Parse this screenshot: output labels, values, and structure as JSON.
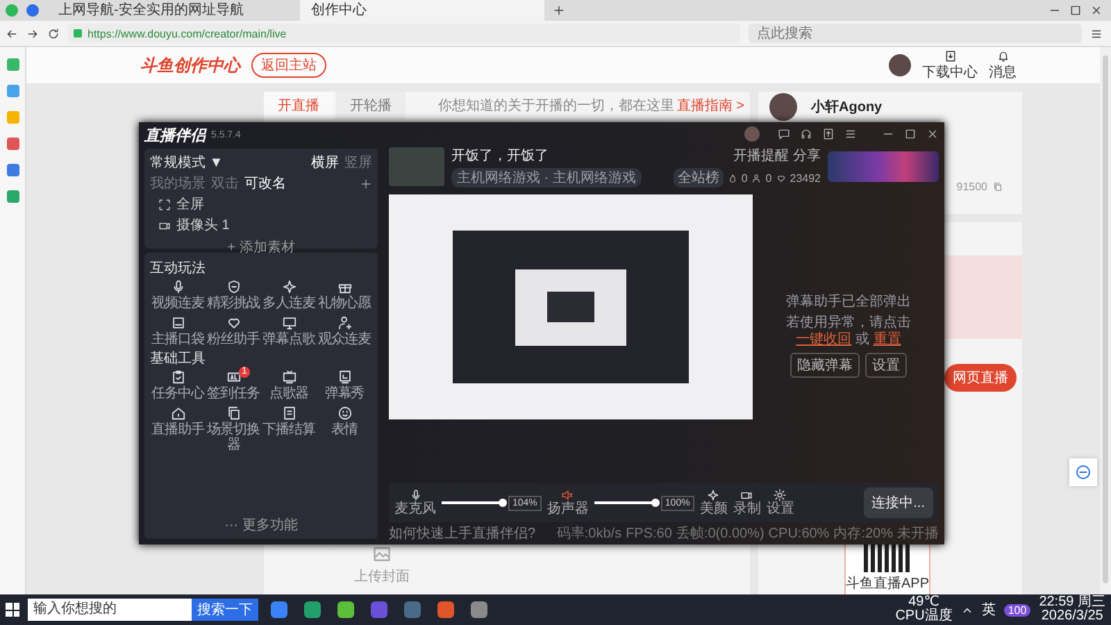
{
  "browser": {
    "tabs": [
      {
        "title": "上网导航-安全实用的网址导航",
        "selected": false
      },
      {
        "title": "创作中心",
        "selected": true
      }
    ],
    "url": "https://www.douyu.com/creator/main/live",
    "search": {
      "placeholder": "点此搜索"
    }
  },
  "header": {
    "logo": "斗鱼创作中心",
    "back_button": "返回主站",
    "actions": [
      "下载中心",
      "消息"
    ]
  },
  "page": {
    "tabs": [
      {
        "label": "开直播",
        "selected": true
      },
      {
        "label": "开轮播",
        "selected": false
      }
    ],
    "hint": "你想知道的关于开播的一切，都在这里",
    "guide_link": "直播指南 >",
    "upload_label": "上传封面"
  },
  "profile": {
    "name": "小轩Agony",
    "room_id": "91500"
  },
  "side_card": {
    "web_live_button": "网页直播",
    "qr_caption": "斗鱼直播APP"
  },
  "app": {
    "name": "直播伴侣",
    "version": "5.5.7.4",
    "mode": "常规模式 ▼",
    "orientations": [
      {
        "label": "横屏",
        "selected": true
      },
      {
        "label": "竖屏",
        "selected": false
      }
    ],
    "scene_tabs": [
      {
        "label": "我的场景",
        "selected": false
      },
      {
        "label": "双击",
        "selected": false
      },
      {
        "label": "可改名",
        "selected": true
      }
    ],
    "sources": [
      {
        "kind": "screen",
        "label": "全屏"
      },
      {
        "kind": "camera",
        "label": "摄像头 1"
      }
    ],
    "add_source": "+ 添加素材",
    "sections": [
      {
        "title": "互动玩法",
        "tools": [
          {
            "label": "视频连麦"
          },
          {
            "label": "精彩挑战"
          },
          {
            "label": "多人连麦"
          },
          {
            "label": "礼物心愿"
          },
          {
            "label": "主播口袋"
          },
          {
            "label": "粉丝助手"
          },
          {
            "label": "弹幕点歌"
          },
          {
            "label": "观众连麦"
          }
        ]
      },
      {
        "title": "基础工具",
        "tools": [
          {
            "label": "任务中心"
          },
          {
            "label": "签到任务",
            "badge": "1"
          },
          {
            "label": "点歌器"
          },
          {
            "label": "弹幕秀"
          },
          {
            "label": "直播助手"
          },
          {
            "label": "场景切换器"
          },
          {
            "label": "下播结算"
          },
          {
            "label": "表情"
          }
        ]
      }
    ],
    "more": "··· 更多功能",
    "stream": {
      "title": "开饭了，开饭了",
      "category": "主机网络游戏 · 主机网络游戏",
      "remind": "开播提醒",
      "share": "分享",
      "rank": "全站榜",
      "stats": [
        "0",
        "0",
        "23492"
      ]
    },
    "assistant": {
      "message": "弹幕助手已全部弹出",
      "hint_prefix": "若使用异常，请点击",
      "links": [
        "一键收回",
        "重置"
      ],
      "joiner": "或",
      "buttons": [
        "隐藏弹幕",
        "设置"
      ]
    },
    "mixer": [
      {
        "kind": "microphone",
        "label": "麦克风",
        "level": 1,
        "reading": "104%",
        "muted": false
      },
      {
        "kind": "speaker",
        "label": "扬声器",
        "level": 1,
        "reading": "100%",
        "muted": true
      }
    ],
    "controls": [
      "美颜",
      "录制",
      "设置"
    ],
    "connect_button": "连接中...",
    "help": "如何快速上手直播伴侣?",
    "status": [
      "码率:0kb/s",
      "FPS:60",
      "丢帧:0(0.00%)",
      "CPU:60%",
      "内存:20%",
      "未开播"
    ]
  },
  "taskbar": {
    "search_placeholder": "输入你想搜的",
    "search_button": "搜索一下",
    "temp": "49℃",
    "temp_label": "CPU温度",
    "ime": "英",
    "tray_badge": "100",
    "time": "22:59 周三",
    "date": "2026/3/25"
  }
}
